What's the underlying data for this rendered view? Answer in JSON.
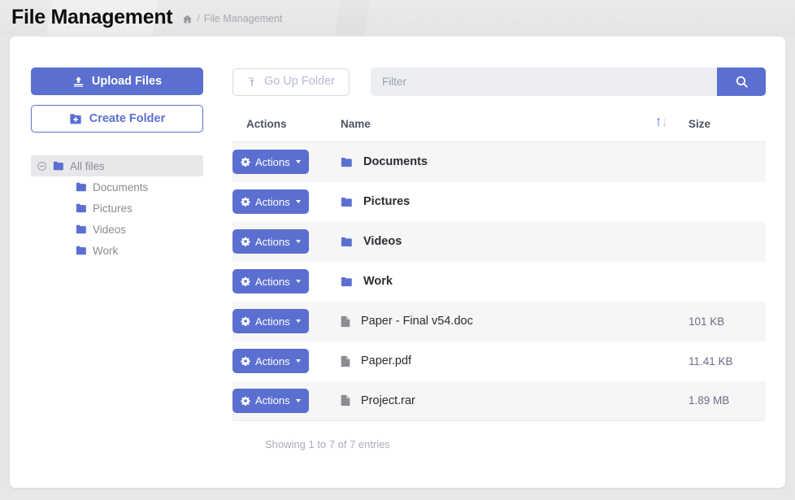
{
  "header": {
    "title": "File Management",
    "breadcrumb": {
      "home_icon": "home-icon",
      "separator": "/",
      "current": "File Management"
    }
  },
  "sidebar": {
    "upload_button": {
      "label": "Upload Files",
      "icon": "upload-icon"
    },
    "create_folder_button": {
      "label": "Create Folder",
      "icon": "folder-plus-icon"
    },
    "tree": [
      {
        "label": "All files",
        "icon": "folder-icon",
        "toggle_icon": "minus-circle-icon",
        "level": 0,
        "selected": true
      },
      {
        "label": "Documents",
        "icon": "folder-icon",
        "level": 1,
        "selected": false
      },
      {
        "label": "Pictures",
        "icon": "folder-icon",
        "level": 1,
        "selected": false
      },
      {
        "label": "Videos",
        "icon": "folder-icon",
        "level": 1,
        "selected": false
      },
      {
        "label": "Work",
        "icon": "folder-icon",
        "level": 1,
        "selected": false
      }
    ]
  },
  "toolbar": {
    "go_up_button": {
      "label": "Go Up Folder",
      "icon": "arrow-up-to-line-icon",
      "disabled": true
    },
    "filter_input": {
      "value": "",
      "placeholder": "Filter"
    },
    "search_button": {
      "icon": "search-icon",
      "label": ""
    }
  },
  "table": {
    "columns": {
      "actions": "Actions",
      "name": "Name",
      "sort": "sort-ascending-icon",
      "size": "Size"
    },
    "action_button_label": "Actions",
    "rows": [
      {
        "name": "Documents",
        "type": "folder",
        "size": "",
        "icon": "folder-icon",
        "action_label": "Actions"
      },
      {
        "name": "Pictures",
        "type": "folder",
        "size": "",
        "icon": "folder-icon",
        "action_label": "Actions"
      },
      {
        "name": "Videos",
        "type": "folder",
        "size": "",
        "icon": "folder-icon",
        "action_label": "Actions"
      },
      {
        "name": "Work",
        "type": "folder",
        "size": "",
        "icon": "folder-icon",
        "action_label": "Actions"
      },
      {
        "name": "Paper - Final v54.doc",
        "type": "file",
        "size": "101 KB",
        "icon": "file-icon",
        "action_label": "Actions"
      },
      {
        "name": "Paper.pdf",
        "type": "file",
        "size": "11.41 KB",
        "icon": "file-icon",
        "action_label": "Actions"
      },
      {
        "name": "Project.rar",
        "type": "file",
        "size": "1.89 MB",
        "icon": "file-icon",
        "action_label": "Actions"
      }
    ],
    "footer": "Showing 1 to 7 of 7 entries"
  },
  "colors": {
    "accent": "#5b6fd1",
    "page_background": "#e7e7e9",
    "card_background": "#ffffff",
    "row_alt_background": "#f6f6f7",
    "muted_text": "#a9acbd"
  }
}
